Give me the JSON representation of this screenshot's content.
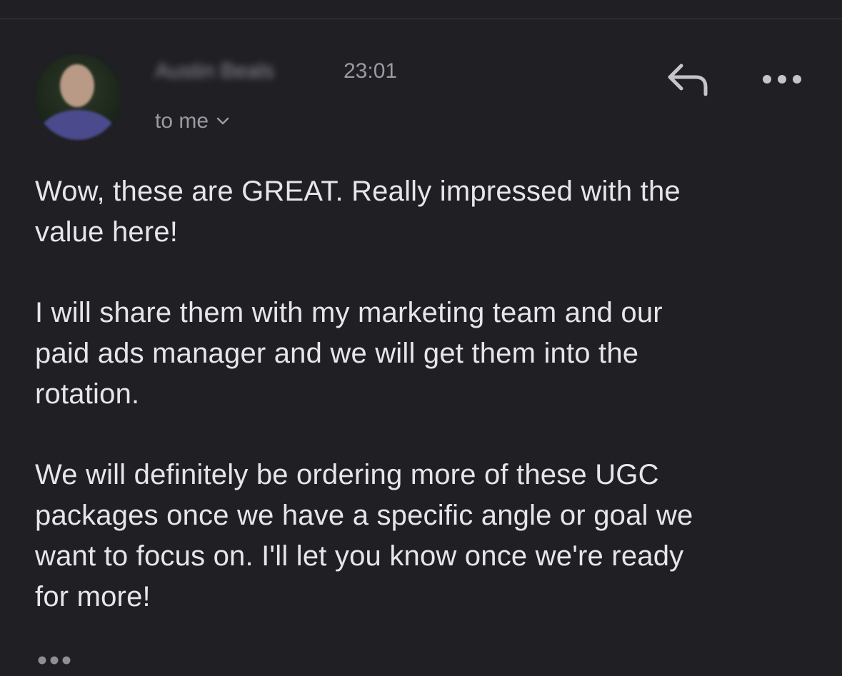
{
  "sender": {
    "name": "Austin Beals",
    "time": "23:01",
    "recipient_label": "to me"
  },
  "message": {
    "paragraphs": [
      "Wow, these are GREAT. Really impressed with the\nvalue here!",
      "I will share them with my marketing team and our\npaid ads manager and we will get them into the\nrotation.",
      "We will definitely be ordering more of these UGC\npackages once we have a specific angle or goal we\nwant to focus on. I'll let you know once we're ready\nfor more!"
    ]
  },
  "icons": {
    "reply": "reply-icon",
    "more": "more-options-icon",
    "chevron": "chevron-down-icon",
    "trimmed": "show-trimmed-content-icon"
  },
  "colors": {
    "background": "#1f1f24",
    "text": "#e6e6ea",
    "muted": "#9a9aa2"
  }
}
